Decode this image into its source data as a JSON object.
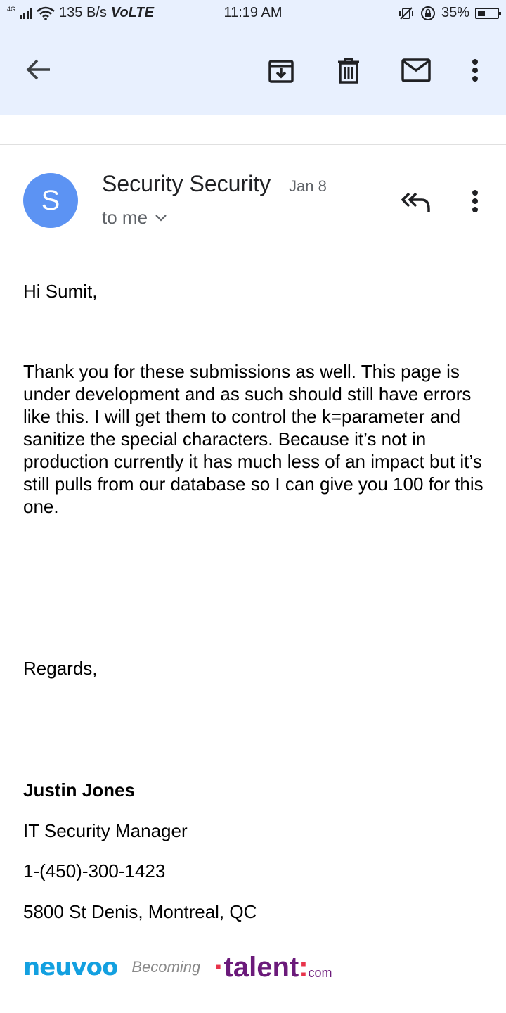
{
  "status_bar": {
    "network_gen": "4G",
    "speed": "135 B/s",
    "volte": "VoLTE",
    "time": "11:19 AM",
    "battery": "35%"
  },
  "toolbar": {
    "back_icon": "arrow-left-icon",
    "archive_icon": "archive-icon",
    "delete_icon": "trash-icon",
    "mark_unread_icon": "mail-icon",
    "overflow_icon": "more-vert-icon"
  },
  "header": {
    "avatar_letter": "S",
    "avatar_color": "#5c93f3",
    "sender": "Security Security",
    "date": "Jan 8",
    "recipient": "to me"
  },
  "message": {
    "greeting": "Hi Sumit,",
    "body": "Thank you for these submissions as well. This page is under development and as such should still have errors like this. I will get them to control the k=parameter and sanitize the special characters. Because it’s not in production currently it has much less of an impact but it’s still pulls from our database so I can give you 100 for this one.",
    "closing": "Regards,"
  },
  "signature": {
    "name": "Justin Jones",
    "title": "IT Security Manager",
    "phone": "1-(450)-300-1423",
    "address": "5800 St Denis, Montreal, QC",
    "logo_text": {
      "brand1": "neuvoo",
      "becoming": "Becoming",
      "brand2": "talent",
      "brand2_suffix": "com"
    }
  }
}
